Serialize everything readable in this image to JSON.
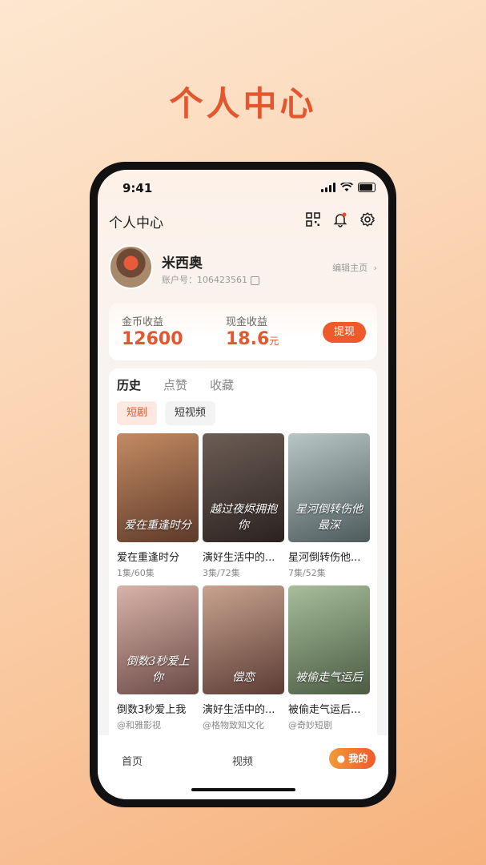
{
  "page": {
    "title": "个人中心"
  },
  "status_bar": {
    "time": "9:41"
  },
  "topbar": {
    "title": "个人中心"
  },
  "profile": {
    "name": "米西奥",
    "account_label": "账户号：",
    "account_id": "106423561",
    "edit_label": "编辑主页"
  },
  "earnings": {
    "coin_label": "金币收益",
    "coin_value": "12600",
    "cash_label": "现金收益",
    "cash_value": "18.6",
    "cash_unit": "元",
    "withdraw_label": "提现"
  },
  "tabs": [
    "历史",
    "点赞",
    "收藏"
  ],
  "chips": [
    "短剧",
    "短视频"
  ],
  "items": [
    {
      "title": "爱在重逢时分",
      "sub": "1集/60集",
      "poster_text": "爱在重逢时分",
      "colors": [
        "#c38b63",
        "#5e3a2a"
      ]
    },
    {
      "title": "演好生活中的...",
      "sub": "3集/72集",
      "poster_text": "越过夜烬拥抱你",
      "colors": [
        "#6d5e55",
        "#2b2220"
      ]
    },
    {
      "title": "星河倒转伤他...",
      "sub": "7集/52集",
      "poster_text": "星河倒转伤他最深",
      "colors": [
        "#b8c7c6",
        "#4e5b5c"
      ]
    },
    {
      "title": "倒数3秒爱上我",
      "sub": "@和雅影视",
      "poster_text": "倒数3秒爱上你",
      "colors": [
        "#d8b3a8",
        "#6b4a47"
      ]
    },
    {
      "title": "演好生活中的...",
      "sub": "@格物致知文化",
      "poster_text": "偿恋",
      "colors": [
        "#c9a38f",
        "#5b3c35"
      ]
    },
    {
      "title": "被偷走气运后...",
      "sub": "@奇妙短剧",
      "poster_text": "被偷走气运后",
      "colors": [
        "#a7bd9b",
        "#4b5c43"
      ]
    }
  ],
  "nav": {
    "home": "首页",
    "video": "视频",
    "me": "我的"
  },
  "colors": {
    "accent": "#e4572e",
    "brand_orange": "#ee5a2b"
  }
}
